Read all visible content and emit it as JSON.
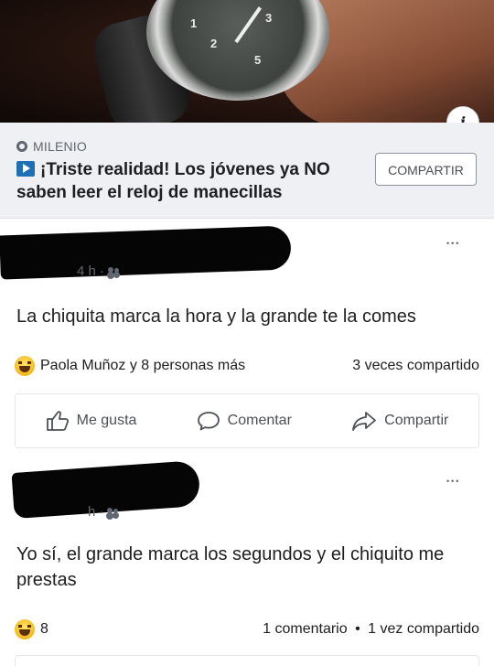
{
  "link_preview": {
    "source": "MILENIO",
    "headline": "¡Triste realidad! Los jóvenes ya NO saben leer el reloj de manecillas",
    "share_button": "COMPARTIR",
    "info_label": "i",
    "watch_numbers": [
      "1",
      "2",
      "3",
      "5"
    ]
  },
  "comments": [
    {
      "time": "4 h",
      "separator": "·",
      "text": "La chiquita marca la hora y la grande te la comes",
      "reactions": "Paola Muñoz y 8 personas más",
      "shares": "3 veces compartido",
      "more": "•••",
      "actions": {
        "like": "Me gusta",
        "comment": "Comentar",
        "share": "Compartir"
      }
    },
    {
      "time": "h",
      "separator": "·",
      "text": "Yo sí, el grande marca los segundos y el chiquito me prestas",
      "reactions": "8",
      "comments_count": "1 comentario",
      "dot": "•",
      "shares": "1 vez compartido",
      "more": "•••"
    }
  ],
  "colors": {
    "preview_bg": "#eef0f3",
    "text": "#1c1e21",
    "meta": "#606770",
    "play_icon": "#1f6fb5",
    "haha_yellow": "#f4b81b"
  }
}
